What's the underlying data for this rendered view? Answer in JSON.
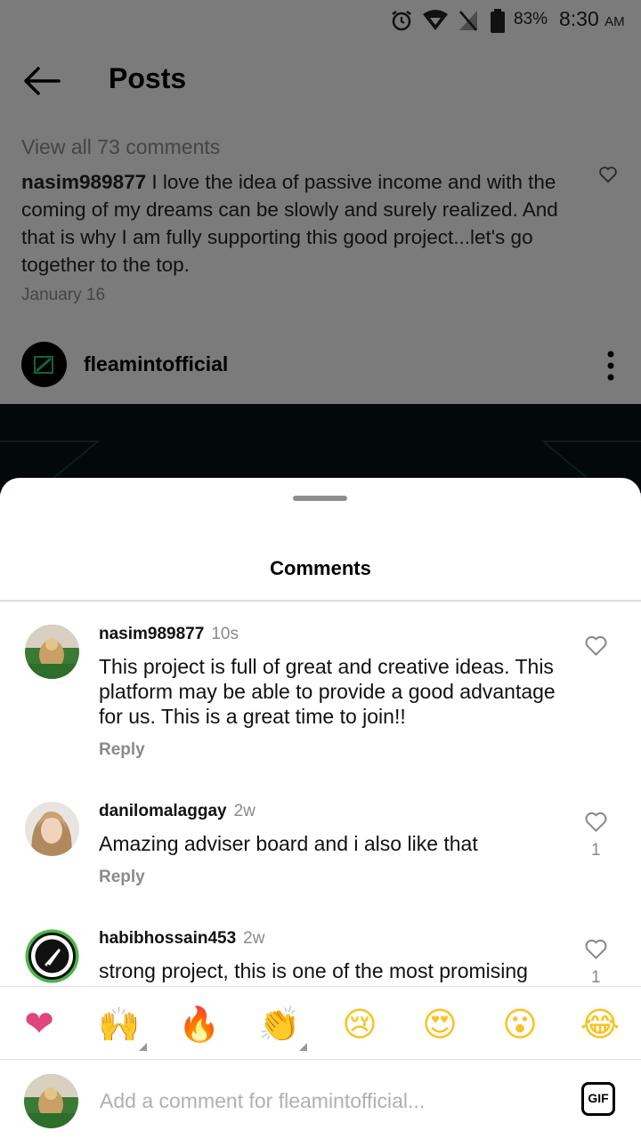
{
  "status_bar": {
    "battery": "83%",
    "time": "8:30",
    "ampm": "AM"
  },
  "header": {
    "title": "Posts"
  },
  "post": {
    "view_all": "View all 73 comments",
    "preview_user": "nasim989877",
    "preview_text": " I love the idea of passive income and with the coming of  my dreams can be slowly and surely realized. And that is why I am fully supporting this good project...let's go together to the top.",
    "preview_date": "January 16",
    "account": "fleamintofficial"
  },
  "sheet": {
    "title": "Comments"
  },
  "comments": [
    {
      "user": "nasim989877",
      "time": "10s",
      "text": "This project is full of great and creative ideas. This platform may be able to provide a good advantage for us. This is a great time to join!!",
      "reply": "Reply",
      "likes": ""
    },
    {
      "user": "danilomalaggay",
      "time": "2w",
      "text": "Amazing adviser board and i also like that",
      "reply": "Reply",
      "likes": "1"
    },
    {
      "user": "habibhossain453",
      "time": "2w",
      "text": "strong project, this is one of the most promising",
      "reply": "",
      "likes": "1"
    }
  ],
  "emoji_bar": {
    "emojis": [
      "❤",
      "🙌",
      "🔥",
      "👏",
      "😢",
      "😍",
      "😮",
      "😂"
    ],
    "icons": [
      "heart-emoji",
      "raised-hands-emoji",
      "fire-emoji",
      "clapping-emoji",
      "crying-emoji",
      "heart-eyes-emoji",
      "surprised-emoji",
      "laughing-emoji"
    ]
  },
  "composer": {
    "placeholder": "Add a comment for fleamintofficial...",
    "gif_label": "GIF"
  },
  "colors": {
    "heart": "#e0457b",
    "emoji_yellow": "#f7c325",
    "dim_overlay": "rgba(0,0,0,0.5)"
  }
}
